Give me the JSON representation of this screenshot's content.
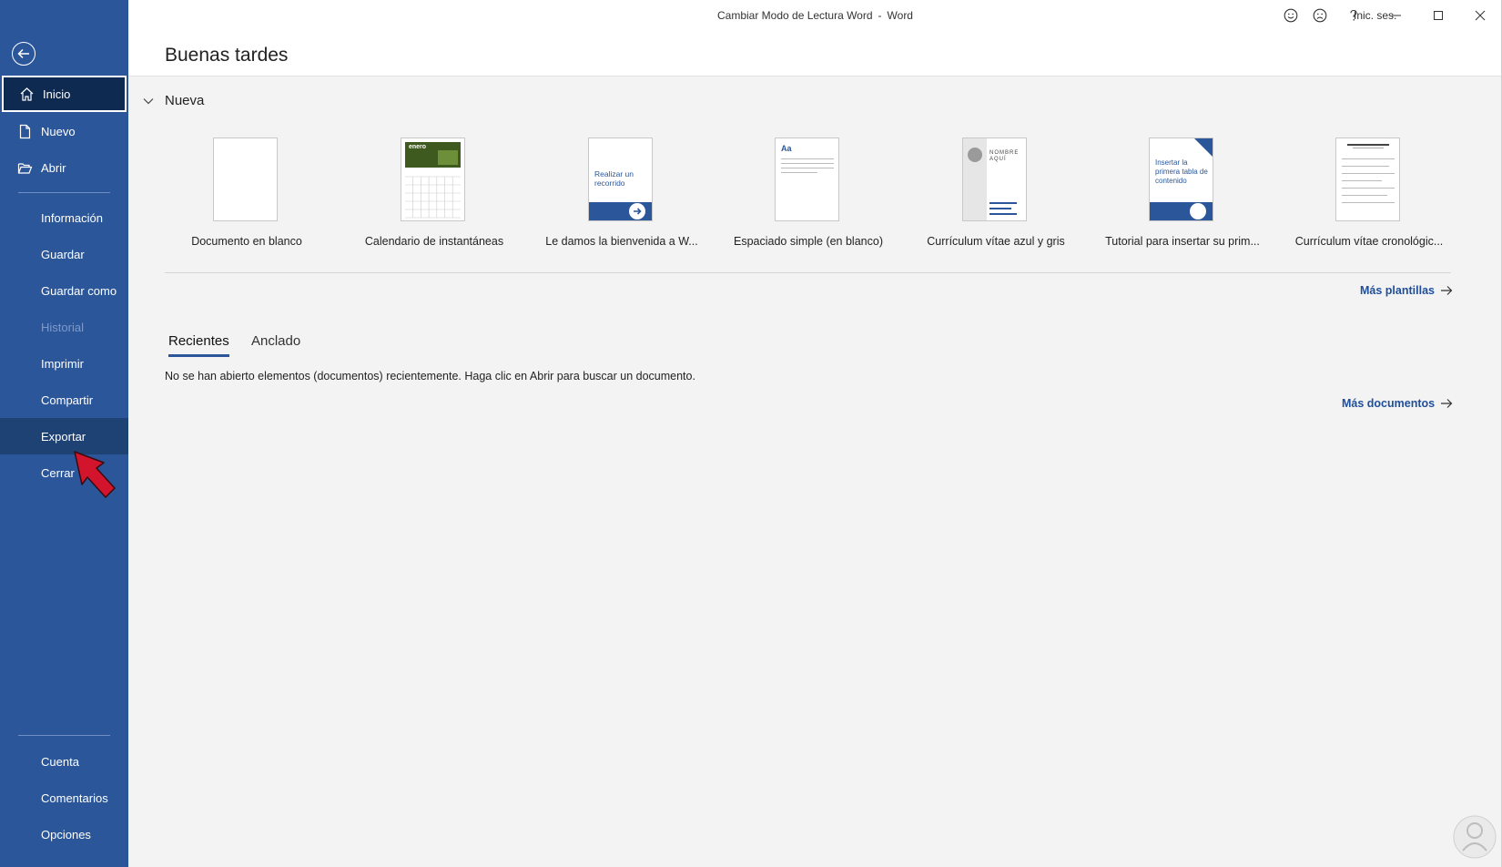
{
  "window": {
    "doc_title": "Cambiar Modo de Lectura Word",
    "separator": "-",
    "app_name": "Word",
    "signin_label": "Inic. ses."
  },
  "colors": {
    "sidebar": "#2b579a",
    "accent": "#2b579a",
    "link": "#1f4e9a",
    "arrow": "#d2152d"
  },
  "sidebar": {
    "items": [
      {
        "label": "Inicio",
        "icon": "home-icon"
      },
      {
        "label": "Nuevo",
        "icon": "new-document-icon"
      },
      {
        "label": "Abrir",
        "icon": "open-folder-icon"
      },
      {
        "label": "Información"
      },
      {
        "label": "Guardar"
      },
      {
        "label": "Guardar como"
      },
      {
        "label": "Historial"
      },
      {
        "label": "Imprimir"
      },
      {
        "label": "Compartir"
      },
      {
        "label": "Exportar"
      },
      {
        "label": "Cerrar"
      },
      {
        "label": "Cuenta"
      },
      {
        "label": "Comentarios"
      },
      {
        "label": "Opciones"
      }
    ]
  },
  "main": {
    "greeting": "Buenas tardes",
    "new_section": "Nueva",
    "templates": [
      {
        "label": "Documento en blanco"
      },
      {
        "label": "Calendario de instantáneas",
        "thumb_text": "enero"
      },
      {
        "label": "Le damos la bienvenida a W...",
        "thumb_text": "Realizar un recorrido"
      },
      {
        "label": "Espaciado simple (en blanco)",
        "thumb_text": "Aa"
      },
      {
        "label": "Currículum vítae azul y gris",
        "thumb_text": "NOMBRE AQUÍ"
      },
      {
        "label": "Tutorial para insertar su prim...",
        "thumb_text": "Insertar la primera tabla de contenido"
      },
      {
        "label": "Currículum vítae cronológic..."
      }
    ],
    "more_templates": "Más plantillas",
    "tabs": [
      {
        "label": "Recientes"
      },
      {
        "label": "Anclado"
      }
    ],
    "empty_message": "No se han abierto elementos (documentos) recientemente. Haga clic en Abrir para buscar un documento.",
    "more_documents": "Más documentos"
  }
}
